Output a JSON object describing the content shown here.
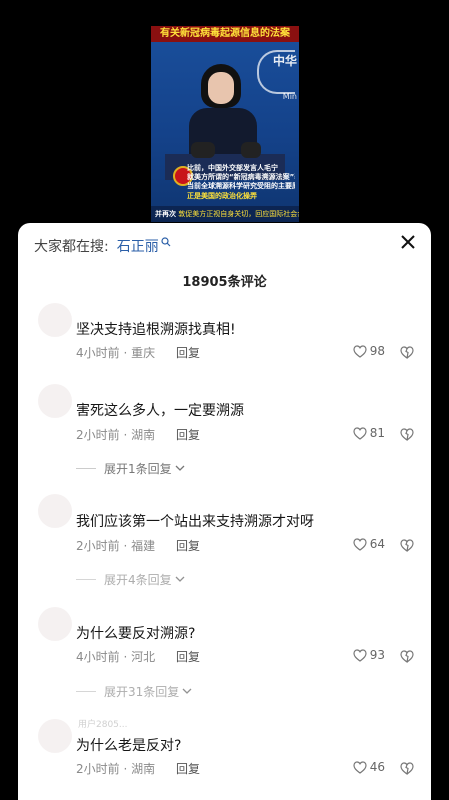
{
  "video": {
    "banner": "有关新冠病毒起源信息的法案",
    "logo_text": "中华",
    "logo_sub": "Min",
    "caption_lines": [
      "比前，中国外交部发言人毛宁",
      "就美方所谓的“新冠病毒溯源法案”表示",
      "当前全球溯源科学研究受阻的主要原因"
    ],
    "caption_highlight": "正是美国的政治化操弄",
    "strip_prefix": "并再次",
    "strip_highlight": "敦促美方正视自身关切，回应国际社会合理关切"
  },
  "search": {
    "label": "大家都在搜:",
    "term": "石正丽"
  },
  "comment_count": "18905条评论",
  "comments": [
    {
      "text": "坚决支持追根溯源找真相!",
      "meta": "4小时前 · 重庆",
      "reply": "回复",
      "likes": "98"
    },
    {
      "text": "害死这么多人，一定要溯源",
      "meta": "2小时前 · 湖南",
      "reply": "回复",
      "likes": "81",
      "expand": "展开1条回复"
    },
    {
      "text": "我们应该第一个站出来支持溯源才对呀",
      "meta": "2小时前 · 福建",
      "reply": "回复",
      "likes": "64",
      "expand": "展开4条回复"
    },
    {
      "text": "为什么要反对溯源?",
      "meta": "4小时前 · 河北",
      "reply": "回复",
      "likes": "93",
      "expand": "展开31条回复"
    },
    {
      "text": "为什么老是反对?",
      "meta": "2小时前 · 湖南",
      "reply": "回复",
      "likes": "46",
      "faint_name": "用户2805..."
    }
  ]
}
